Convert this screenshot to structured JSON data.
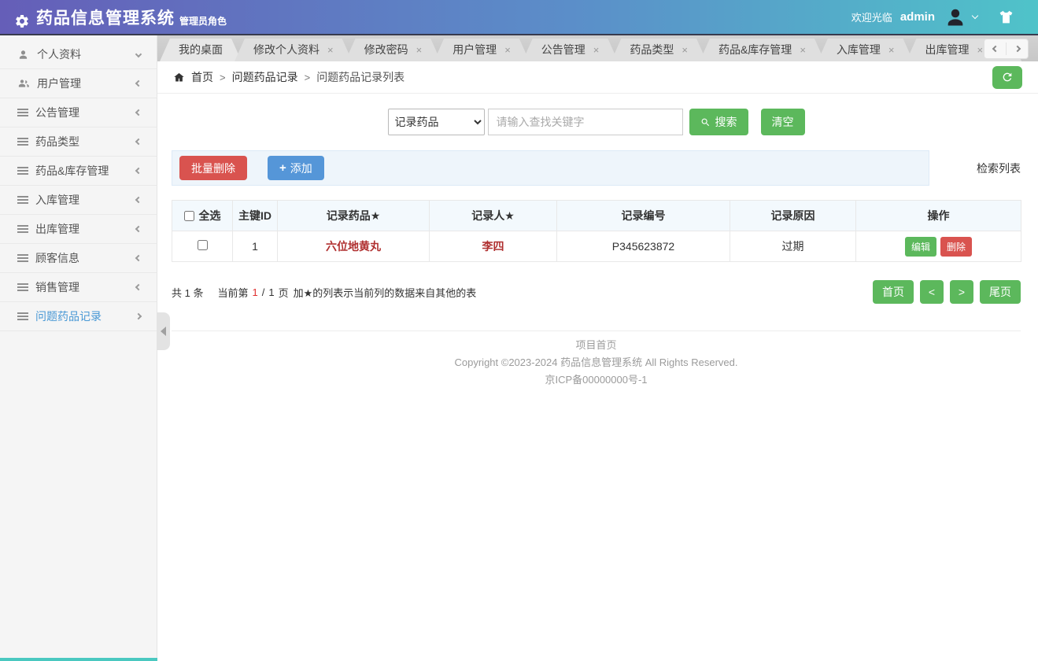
{
  "header": {
    "title": "药品信息管理系统",
    "role_badge": "管理员角色",
    "welcome_text": "欢迎光临",
    "username": "admin"
  },
  "sidebar": {
    "items": [
      {
        "label": "个人资料"
      },
      {
        "label": "用户管理"
      },
      {
        "label": "公告管理"
      },
      {
        "label": "药品类型"
      },
      {
        "label": "药品&库存管理"
      },
      {
        "label": "入库管理"
      },
      {
        "label": "出库管理"
      },
      {
        "label": "顾客信息"
      },
      {
        "label": "销售管理"
      },
      {
        "label": "问题药品记录"
      }
    ]
  },
  "tabs": {
    "items": [
      {
        "label": "我的桌面",
        "closable": false
      },
      {
        "label": "修改个人资料",
        "closable": true
      },
      {
        "label": "修改密码",
        "closable": true
      },
      {
        "label": "用户管理",
        "closable": true
      },
      {
        "label": "公告管理",
        "closable": true
      },
      {
        "label": "药品类型",
        "closable": true
      },
      {
        "label": "药品&库存管理",
        "closable": true
      },
      {
        "label": "入库管理",
        "closable": true
      },
      {
        "label": "出库管理",
        "closable": true
      }
    ]
  },
  "breadcrumb": {
    "home_label": "首页",
    "separator": ">",
    "items": [
      "问题药品记录",
      "问题药品记录列表"
    ]
  },
  "search": {
    "field_selected": "记录药品",
    "placeholder": "请输入查找关键字",
    "search_label": "搜索",
    "clear_label": "清空"
  },
  "toolbar": {
    "batch_delete_label": "批量删除",
    "add_label": "添加",
    "list_title": "检索列表"
  },
  "table": {
    "headers": [
      "全选",
      "主键ID",
      "记录药品★",
      "记录人★",
      "记录编号",
      "记录原因",
      "操作"
    ],
    "rows": [
      {
        "id": "1",
        "drug": "六位地黄丸",
        "recorder": "李四",
        "code": "P345623872",
        "reason": "过期"
      }
    ],
    "edit_label": "编辑",
    "delete_label": "删除"
  },
  "pagination": {
    "total_label": "共 1 条",
    "current_prefix": "当前第",
    "current_page": "1",
    "divider": "/",
    "total_pages": "1",
    "page_unit": "页",
    "star_note": "加★的列表示当前列的数据来自其他的表",
    "first_label": "首页",
    "last_label": "尾页"
  },
  "footer": {
    "home_link": "项目首页",
    "copyright": "Copyright ©2023-2024 药品信息管理系统 All Rights Reserved.",
    "icp": "京ICP备00000000号-1"
  },
  "glyphs": {
    "plus": "+",
    "close": "×",
    "prev": "<",
    "next": ">"
  },
  "colors": {
    "header_gradient_start": "#655eb8",
    "header_gradient_end": "#4fc3c9",
    "accent_green": "#5cb85c",
    "danger_red": "#d9534f",
    "primary_blue": "#5596d8",
    "active_link_blue": "#4898d5",
    "record_red": "#b03030",
    "toolbar_bg": "#eef5fb"
  }
}
